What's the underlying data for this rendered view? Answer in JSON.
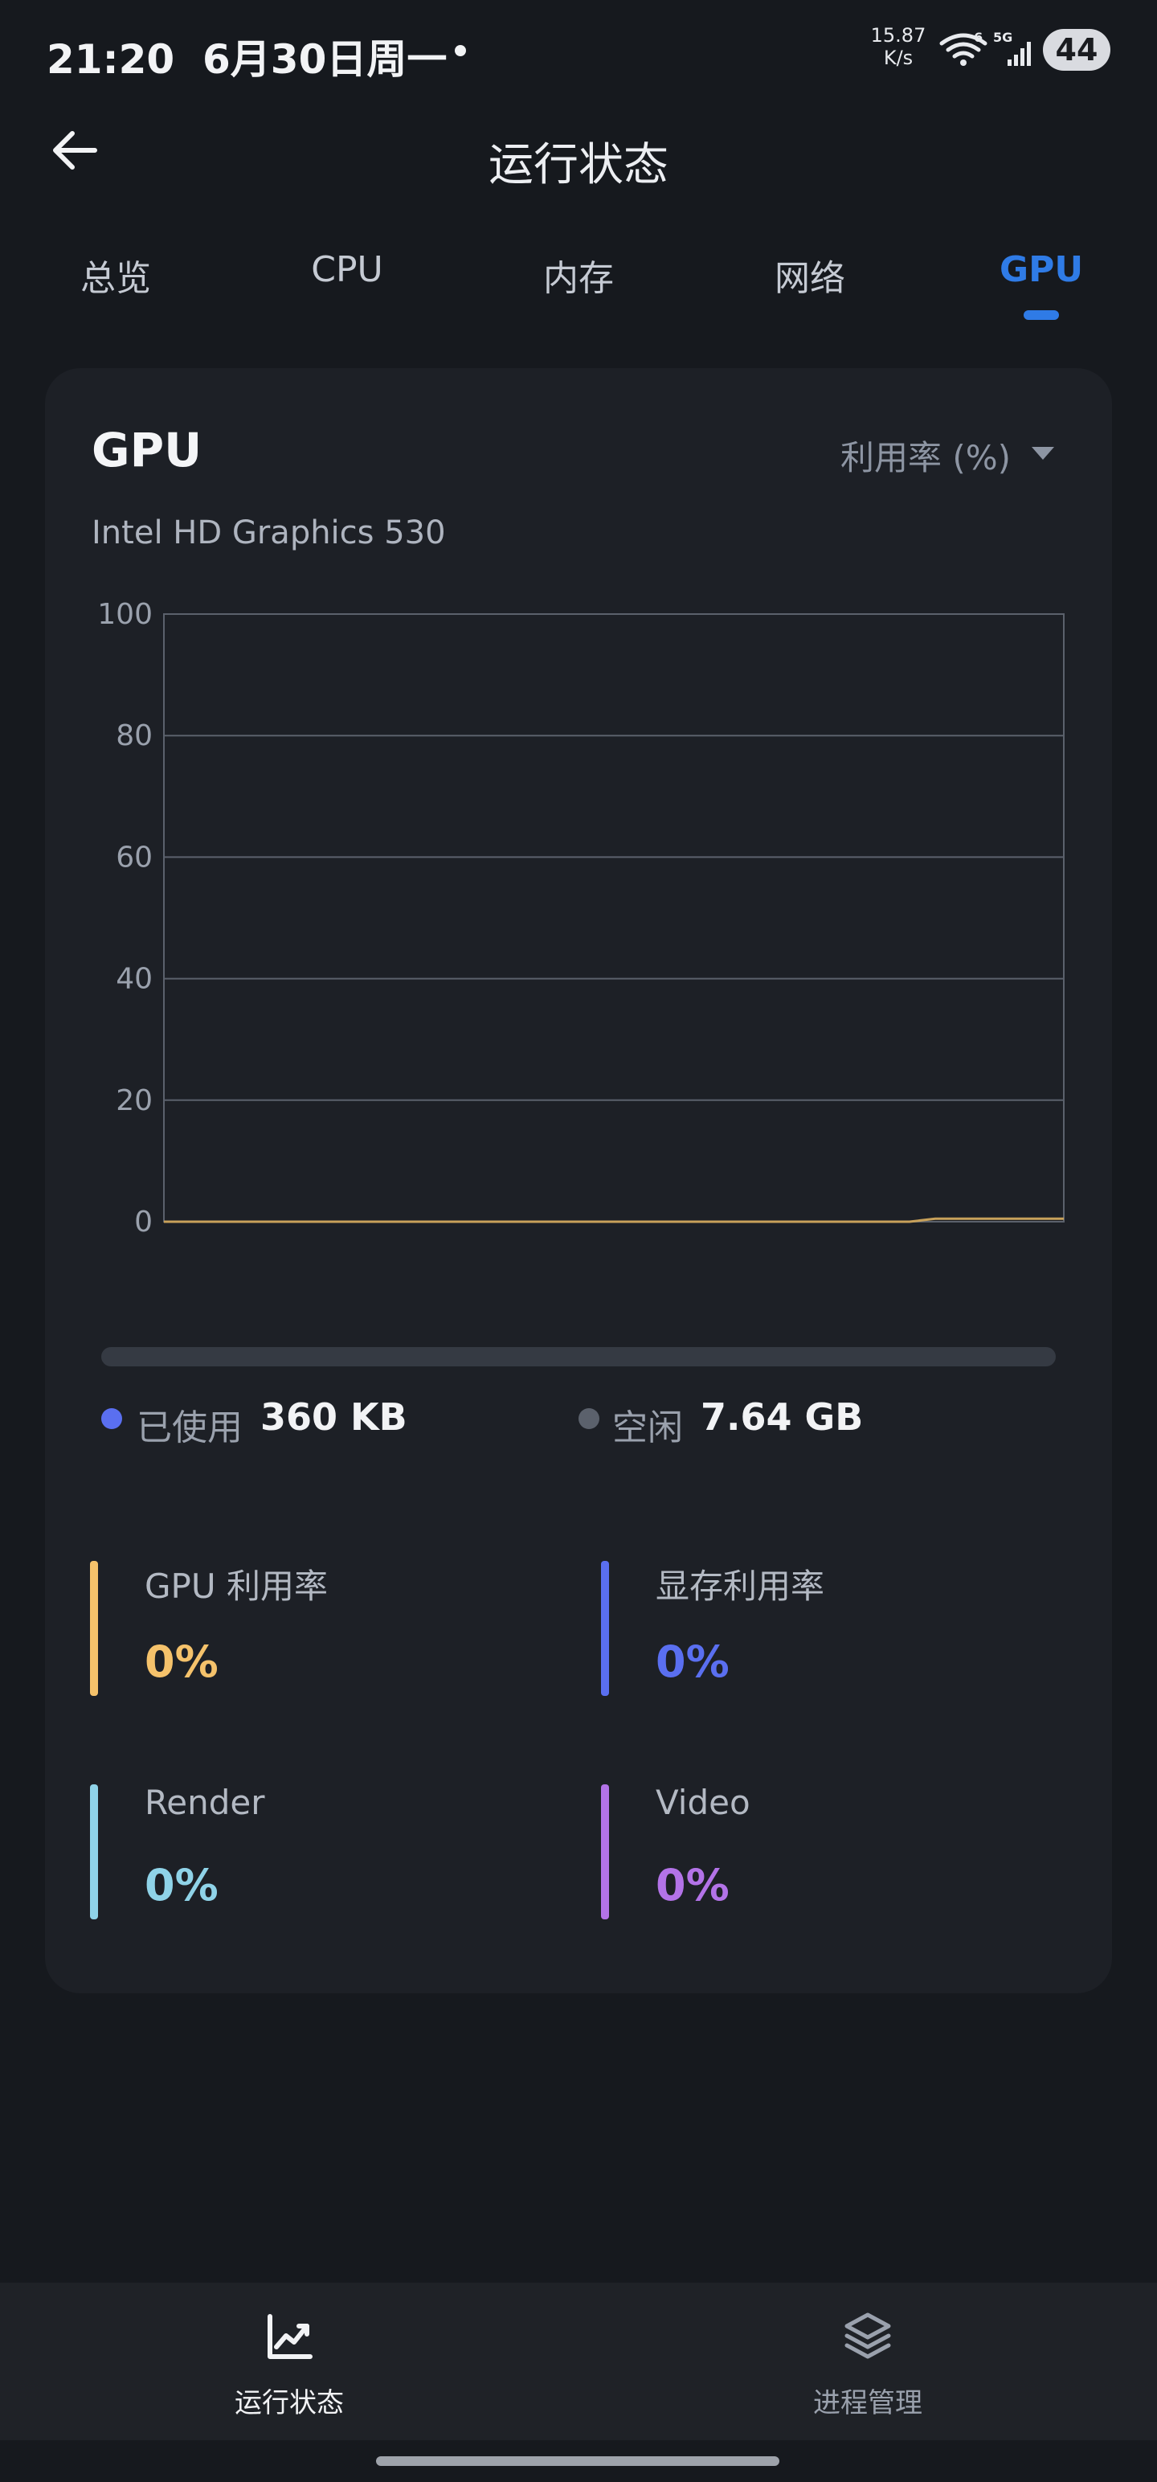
{
  "status_bar": {
    "time": "21:20",
    "date": "6月30日周一",
    "net_speed_value": "15.87",
    "net_speed_unit": "K/s",
    "wifi_badge": "6",
    "cell_label": "5G",
    "battery": "44"
  },
  "header": {
    "title": "运行状态"
  },
  "tabs": [
    {
      "label": "总览"
    },
    {
      "label": "CPU"
    },
    {
      "label": "内存"
    },
    {
      "label": "网络"
    },
    {
      "label": "GPU",
      "active": true
    }
  ],
  "card": {
    "title": "GPU",
    "metric_selector": "利用率 (%)",
    "device_name": "Intel HD Graphics 530"
  },
  "chart_data": {
    "type": "line",
    "yticks": [
      "100",
      "80",
      "60",
      "40",
      "20",
      "0"
    ],
    "ylim": [
      0,
      100
    ],
    "grid": true,
    "series": [
      {
        "values": [
          0,
          0,
          0,
          0,
          0,
          0,
          0,
          0,
          0,
          0,
          0,
          0,
          0,
          0,
          0,
          0,
          0,
          0,
          0,
          0,
          0,
          0,
          0,
          0,
          0,
          0,
          0,
          0,
          0,
          0,
          0.5,
          0.5,
          0.5,
          0.5,
          0.5,
          0.5
        ],
        "color": "#c8a15a"
      }
    ]
  },
  "memory": {
    "used_label": "已使用",
    "used_value": "360 KB",
    "free_label": "空闲",
    "free_value": "7.64 GB",
    "used_color": "#5a6ff0",
    "free_color": "#5b616c"
  },
  "stats": [
    {
      "label": "GPU 利用率",
      "value": "0%",
      "color": "#f5c26b"
    },
    {
      "label": "显存利用率",
      "value": "0%",
      "color": "#5a6ff0"
    },
    {
      "label": "Render",
      "value": "0%",
      "color": "#8fd3e8"
    },
    {
      "label": "Video",
      "value": "0%",
      "color": "#b373e8"
    }
  ],
  "bottom_nav": [
    {
      "label": "运行状态",
      "icon": "chart-line-icon",
      "active": true
    },
    {
      "label": "进程管理",
      "icon": "layers-icon",
      "active": false
    }
  ]
}
